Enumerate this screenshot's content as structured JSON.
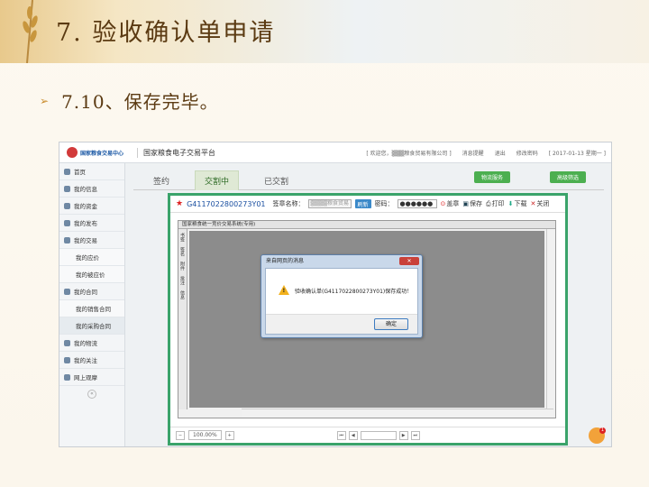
{
  "slide": {
    "title": "7. 验收确认单申请",
    "subtitle": "7.10、保存完毕。"
  },
  "app": {
    "logo_text": "国家粮食交易中心",
    "platform_title": "国家粮食电子交易平台",
    "topbar": {
      "welcome": "[ 欢迎您，▒▒▒粮食贸易有限公司 ]",
      "messages": "消息提醒",
      "logout": "退出",
      "change_password": "修改密码",
      "date": "[ 2017-01-13 星期一 ]"
    },
    "sidebar": {
      "items": [
        {
          "label": "首页",
          "sub": false
        },
        {
          "label": "我的信息",
          "sub": false
        },
        {
          "label": "我的资金",
          "sub": false
        },
        {
          "label": "我的发布",
          "sub": false
        },
        {
          "label": "我的交易",
          "sub": false
        },
        {
          "label": "我的应价",
          "sub": true
        },
        {
          "label": "我的被应价",
          "sub": true
        },
        {
          "label": "我的合同",
          "sub": false
        },
        {
          "label": "我的销售合同",
          "sub": true
        },
        {
          "label": "我的采购合同",
          "sub": true
        },
        {
          "label": "我的物流",
          "sub": false
        },
        {
          "label": "我的关注",
          "sub": false
        },
        {
          "label": "网上观摩",
          "sub": false
        }
      ]
    },
    "tabs": [
      "签约",
      "交割中",
      "已交割"
    ],
    "buttons": {
      "logistics": "物流服务",
      "advanced_filter": "高级筛选"
    }
  },
  "document": {
    "id": "G4117022800273Y01",
    "signer_label": "签章名称：",
    "signer_value": "▒▒▒▒粮食贸易",
    "refresh": "刷新",
    "password_label": "密码：",
    "password_value": "●●●●●●",
    "stamp": "盖章",
    "save": "保存",
    "print": "打印",
    "download": "下载",
    "close": "关闭",
    "viewer_title": "国家粮食统一竞价交易系统(专用)",
    "left_tabs": [
      "书签",
      "签名",
      "附件",
      "批注",
      "信息"
    ],
    "zoom": "100.00%"
  },
  "dialog": {
    "title": "来自网页的消息",
    "message": "验收确认单(G4117022800273Y01)保存成功！",
    "ok_label": "确定"
  }
}
